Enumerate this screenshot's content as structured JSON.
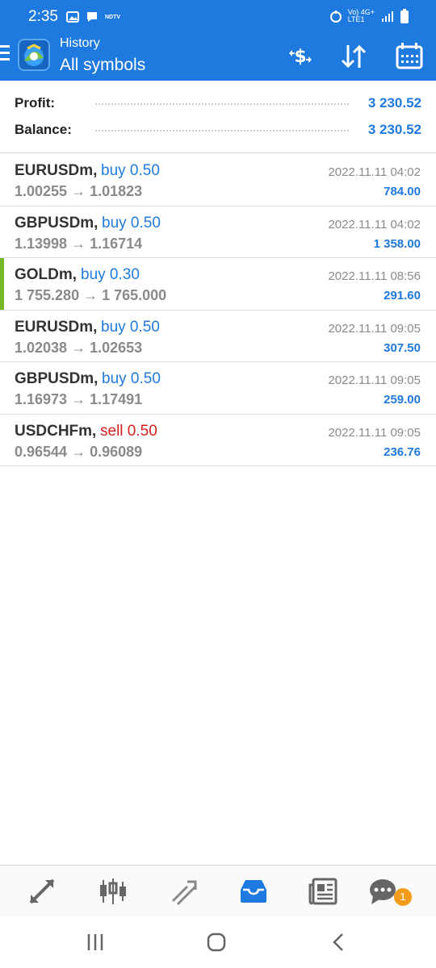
{
  "status_bar": {
    "time": "2:35",
    "network_label": "NDTV",
    "signal_text_1": "Vo) 4G+",
    "signal_text_2": "LTE1"
  },
  "app_bar": {
    "subtitle": "History",
    "title": "All symbols",
    "icons": [
      "menu-icon",
      "app-logo",
      "deposit-icon",
      "sort-icon",
      "calendar-icon"
    ]
  },
  "summary": {
    "profit_label": "Profit:",
    "profit_value": "3 230.52",
    "balance_label": "Balance:",
    "balance_value": "3 230.52"
  },
  "trades": [
    {
      "symbol": "EURUSDm,",
      "side": "buy 0.50",
      "side_color": "#1f7ae0",
      "prices": "1.00255 → 1.01823",
      "date": "2022.11.11 04:02",
      "profit": "784.00",
      "accent": ""
    },
    {
      "symbol": "GBPUSDm,",
      "side": "buy 0.50",
      "side_color": "#1f7ae0",
      "prices": "1.13998 → 1.16714",
      "date": "2022.11.11 04:02",
      "profit": "1 358.00",
      "accent": ""
    },
    {
      "symbol": "GOLDm,",
      "side": "buy 0.30",
      "side_color": "#1f7ae0",
      "prices": "1 755.280 → 1 765.000",
      "date": "2022.11.11 08:56",
      "profit": "291.60",
      "accent": "#77b82a"
    },
    {
      "symbol": "EURUSDm,",
      "side": "buy 0.50",
      "side_color": "#1f7ae0",
      "prices": "1.02038 → 1.02653",
      "date": "2022.11.11 09:05",
      "profit": "307.50",
      "accent": ""
    },
    {
      "symbol": "GBPUSDm,",
      "side": "buy 0.50",
      "side_color": "#1f7ae0",
      "prices": "1.16973 → 1.17491",
      "date": "2022.11.11 09:05",
      "profit": "259.00",
      "accent": ""
    },
    {
      "symbol": "USDCHFm,",
      "side": "sell 0.50",
      "side_color": "#d62020",
      "prices": "0.96544 → 0.96089",
      "date": "2022.11.11 09:05",
      "profit": "236.76",
      "accent": ""
    }
  ],
  "bottom_nav": {
    "items": [
      "quotes-icon",
      "chart-icon",
      "trade-icon",
      "history-icon",
      "news-icon",
      "chat-icon"
    ],
    "active": "history-icon",
    "chat_badge": "1"
  },
  "colors": {
    "primary": "#1f7ae0",
    "sell": "#d62020",
    "accent_green": "#77b82a",
    "badge": "#f29c1b"
  }
}
